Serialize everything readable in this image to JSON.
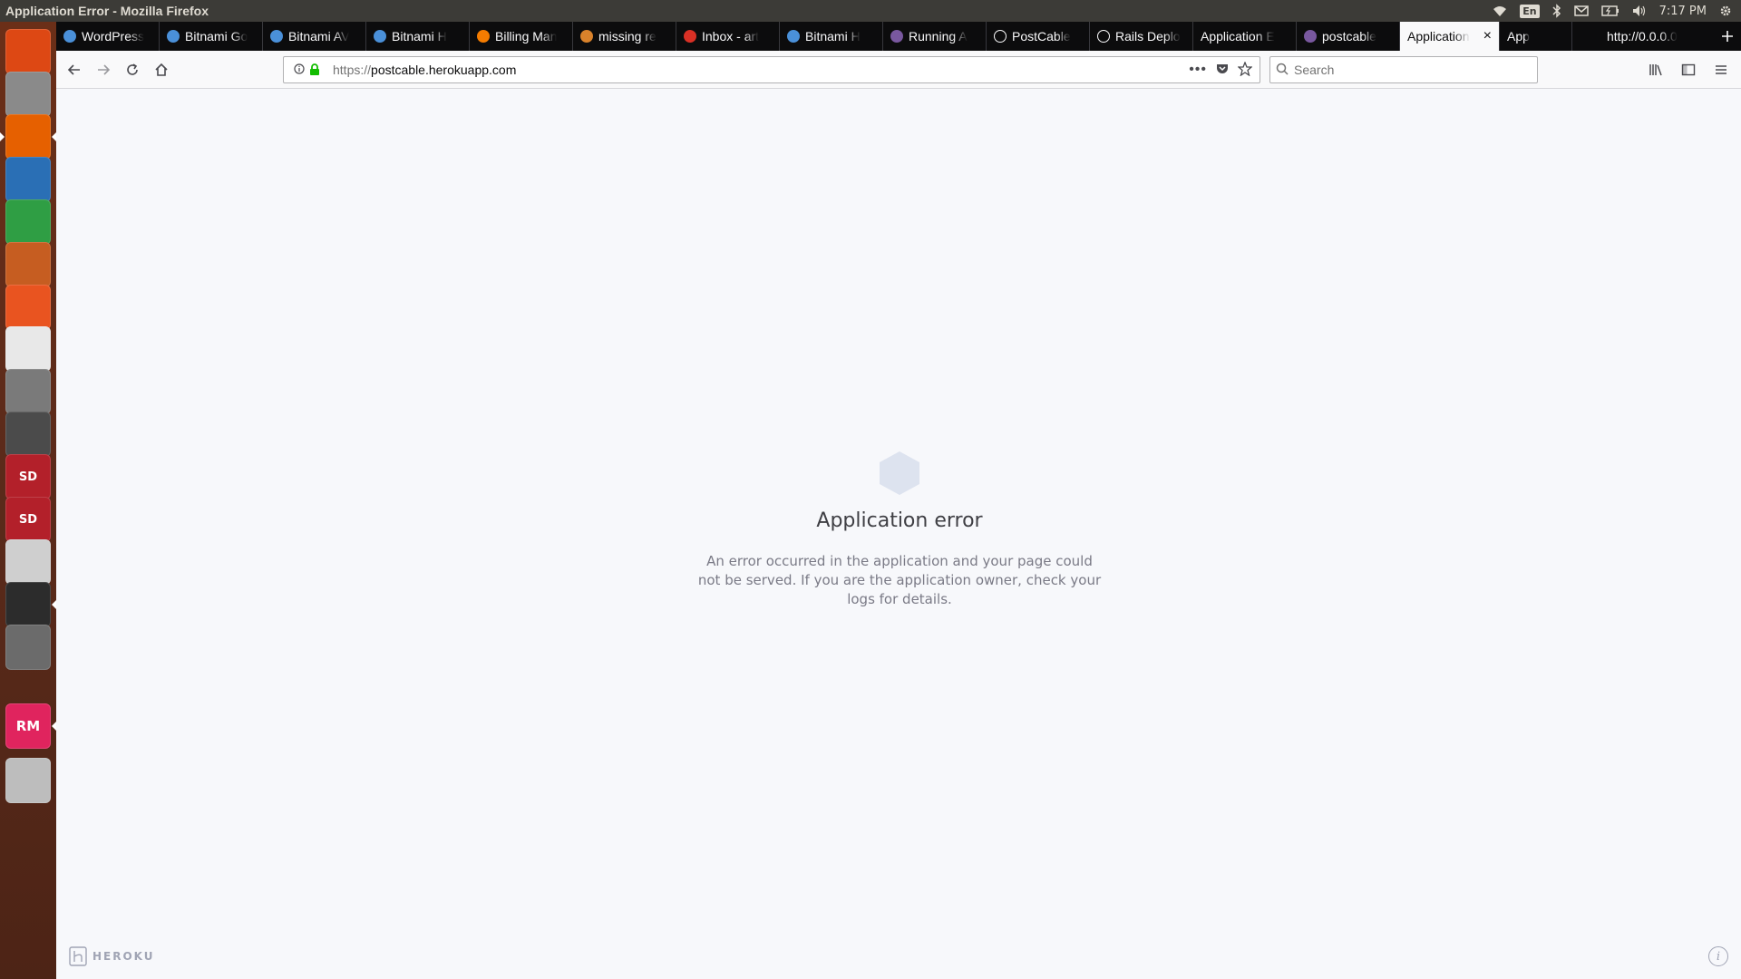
{
  "window": {
    "title": "Application Error - Mozilla Firefox"
  },
  "panel": {
    "keyboard_layout": "En",
    "clock": "7:17 PM"
  },
  "launcher": {
    "items": [
      {
        "name": "ubuntu-dash-icon",
        "color": "#dd4814"
      },
      {
        "name": "files-icon",
        "color": "#8a8a8a"
      },
      {
        "name": "firefox-icon",
        "color": "#e66000"
      },
      {
        "name": "writer-icon",
        "color": "#2a6fb5"
      },
      {
        "name": "calc-icon",
        "color": "#2f9e44"
      },
      {
        "name": "impress-icon",
        "color": "#c65d21"
      },
      {
        "name": "software-center-icon",
        "color": "#e95420"
      },
      {
        "name": "amazon-icon",
        "color": "#e8e8e8"
      },
      {
        "name": "system-settings-icon",
        "color": "#7a7a7a"
      },
      {
        "name": "sublime-text-icon",
        "color": "#4b4b4b"
      },
      {
        "name": "sd-card-icon",
        "color": "#b3202a",
        "label": "SD"
      },
      {
        "name": "sd-card-icon-2",
        "color": "#b3202a",
        "label": "SD"
      },
      {
        "name": "usb-drive-icon",
        "color": "#cfcfcf"
      },
      {
        "name": "terminal-icon",
        "color": "#2c2c2c"
      },
      {
        "name": "screenshot-icon",
        "color": "#6b6b6b"
      },
      {
        "name": "rubymine-icon",
        "color": "#e0245e",
        "label": "RM"
      },
      {
        "name": "trash-icon",
        "color": "#bdbdbd"
      }
    ]
  },
  "tabs": [
    {
      "title": "WordPress",
      "fav": "#4a90d9"
    },
    {
      "title": "Bitnami Go",
      "fav": "#4a90d9"
    },
    {
      "title": "Bitnami AV",
      "fav": "#4a90d9"
    },
    {
      "title": "Bitnami H",
      "fav": "#4a90d9"
    },
    {
      "title": "Billing Man",
      "fav": "#f57c00"
    },
    {
      "title": "missing re",
      "fav": "#d9822b"
    },
    {
      "title": "Inbox - art",
      "fav": "#d93025"
    },
    {
      "title": "Bitnami H",
      "fav": "#4a90d9"
    },
    {
      "title": "Running A",
      "fav": "#79589f"
    },
    {
      "title": "PostCable",
      "fav": "#ffffff"
    },
    {
      "title": "Rails Deplo",
      "fav": "#ffffff"
    },
    {
      "title": "Application E",
      "fav": ""
    },
    {
      "title": "postcable",
      "fav": "#79589f"
    }
  ],
  "selected_tab": {
    "title": "Application",
    "close": "×"
  },
  "extra_tab": {
    "title": "App"
  },
  "url_tab": {
    "title": "http://0.0.0.0"
  },
  "nav": {
    "url_scheme": "https://",
    "url_host": "postcable.herokuapp.com",
    "search_placeholder": "Search"
  },
  "error": {
    "title": "Application error",
    "message": "An error occurred in the application and your page could not be served. If you are the application owner, check your logs for details."
  },
  "footer": {
    "brand": "HEROKU",
    "info": "i"
  }
}
